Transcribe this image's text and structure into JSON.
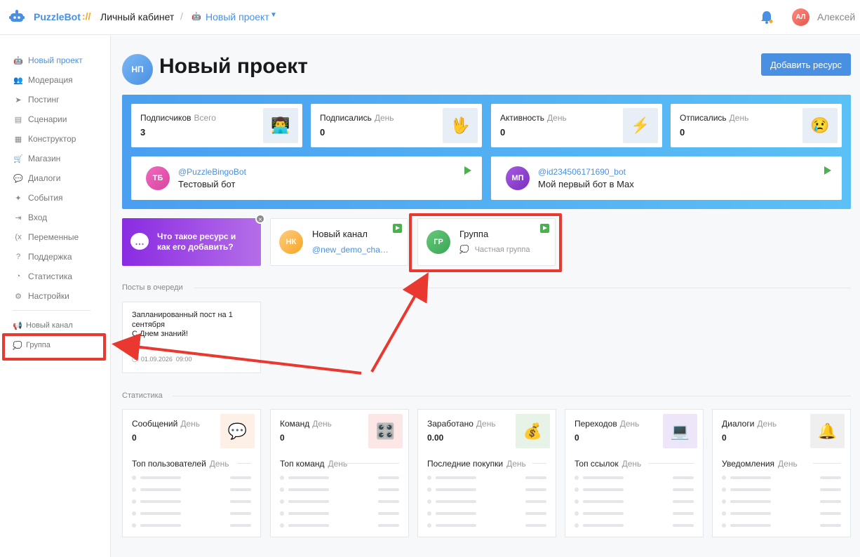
{
  "topbar": {
    "brand": "PuzzleBot",
    "brand_sep": "://",
    "crumb_cabinet": "Личный кабинет",
    "crumb_project": "Новый проект",
    "user_initials": "АЛ",
    "user_name": "Алексей"
  },
  "sidebar": {
    "items": [
      {
        "label": "Новый проект",
        "icon": "bot-icon"
      },
      {
        "label": "Модерация",
        "icon": "users-icon"
      },
      {
        "label": "Постинг",
        "icon": "paper-plane-icon"
      },
      {
        "label": "Сценарии",
        "icon": "scenarios-icon"
      },
      {
        "label": "Конструктор",
        "icon": "constructor-icon"
      },
      {
        "label": "Магазин",
        "icon": "cart-icon"
      },
      {
        "label": "Диалоги",
        "icon": "chat-icon"
      },
      {
        "label": "События",
        "icon": "puzzle-icon"
      },
      {
        "label": "Вход",
        "icon": "login-icon"
      },
      {
        "label": "Переменные",
        "icon": "variable-icon"
      },
      {
        "label": "Поддержка",
        "icon": "help-icon"
      },
      {
        "label": "Статистика",
        "icon": "pie-icon"
      },
      {
        "label": "Настройки",
        "icon": "gear-icon"
      }
    ],
    "resources": [
      {
        "label": "Новый канал",
        "icon": "channel-icon"
      },
      {
        "label": "Группа",
        "icon": "group-icon"
      }
    ]
  },
  "project": {
    "initials": "НП",
    "title": "Новый проект",
    "add_button": "Добавить ресурс"
  },
  "stats": [
    {
      "label": "Подписчиков",
      "period": "Всего",
      "value": "3",
      "icon": "coder-emoji"
    },
    {
      "label": "Подписались",
      "period": "День",
      "value": "0",
      "icon": "wave-hand-emoji"
    },
    {
      "label": "Активность",
      "period": "День",
      "value": "0",
      "icon": "lightning-emoji"
    },
    {
      "label": "Отписались",
      "period": "День",
      "value": "0",
      "icon": "sad-face-emoji"
    }
  ],
  "bots": [
    {
      "initials": "ТБ",
      "handle": "@PuzzleBingoBot",
      "name": "Тестовый бот"
    },
    {
      "initials": "МП",
      "handle": "@id234506171690_bot",
      "name": "Мой первый бот в Max"
    }
  ],
  "promo": {
    "text": "Что такое ресурс и как его добавить?"
  },
  "resources": [
    {
      "initials": "НК",
      "name": "Новый канал",
      "sub": "@new_demo_channel"
    },
    {
      "initials": "ГР",
      "name": "Группа",
      "sub": "Частная группа"
    }
  ],
  "queue": {
    "title": "Посты в очереди",
    "post_text": "Запланированный пост на 1 сентября\nС Днем знаний!",
    "post_line1": "Запланированный пост на 1",
    "post_line2": "сентября",
    "post_line3": "С Днем знаний!",
    "post_date": "01.09.2026",
    "post_time": "09:00"
  },
  "statistics": {
    "title": "Статистика",
    "cards": [
      {
        "label": "Сообщений",
        "period": "День",
        "value": "0",
        "icon": "speech-bubble-emoji",
        "bg": "#fdf0e6",
        "sub": "Топ пользователей",
        "sub_period": "День"
      },
      {
        "label": "Команд",
        "period": "День",
        "value": "0",
        "icon": "control-knobs-emoji",
        "bg": "#fde6e6",
        "sub": "Топ команд",
        "sub_period": "День"
      },
      {
        "label": "Заработано",
        "period": "День",
        "value": "0.00",
        "icon": "money-bag-emoji",
        "bg": "#e6f3e6",
        "sub": "Последние покупки",
        "sub_period": "День"
      },
      {
        "label": "Переходов",
        "period": "День",
        "value": "0",
        "icon": "laptop-emoji",
        "bg": "#ece6f8",
        "sub": "Топ ссылок",
        "sub_period": "День"
      },
      {
        "label": "Диалоги",
        "period": "День",
        "value": "0",
        "icon": "bell-emoji",
        "bg": "#efefef",
        "sub": "Уведомления",
        "sub_period": "День"
      }
    ]
  },
  "colors": {
    "accent": "#4a90e2",
    "highlight": "#e8382f",
    "hero_gradient_start": "#4a9ff0",
    "hero_gradient_end": "#5bc0f5",
    "promo_gradient_start": "#8a2be2",
    "promo_gradient_end": "#b46ee8"
  }
}
